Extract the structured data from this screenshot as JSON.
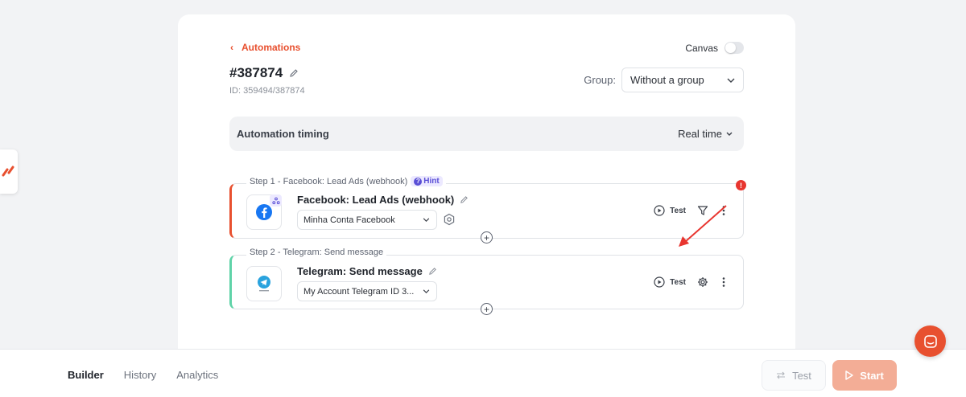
{
  "header": {
    "back_label": "Automations",
    "canvas_label": "Canvas",
    "title": "#387874",
    "id_text": "ID: 359494/387874",
    "group_label": "Group:",
    "group_value": "Without a group"
  },
  "timing": {
    "label": "Automation timing",
    "value": "Real time"
  },
  "steps": [
    {
      "legend": "Step 1 - Facebook: Lead Ads (webhook)",
      "hint_label": "Hint",
      "app_name": "Facebook: Lead Ads (webhook)",
      "account": "Minha Conta Facebook",
      "test_label": "Test",
      "icon": "facebook-icon",
      "accent": "#e8502f"
    },
    {
      "legend": "Step 2 - Telegram: Send message",
      "app_name": "Telegram: Send message",
      "account": "My Account Telegram ID 3...",
      "test_label": "Test",
      "icon": "telegram-icon",
      "accent": "#5fd3a8"
    }
  ],
  "error_badge": "!",
  "bottom": {
    "tabs": [
      "Builder",
      "History",
      "Analytics"
    ],
    "active_tab": "Builder",
    "test_button": "Test",
    "start_button": "Start"
  },
  "colors": {
    "brand": "#e8502f",
    "start_bg": "#f3ad96",
    "hint": "#5a4fd6"
  }
}
